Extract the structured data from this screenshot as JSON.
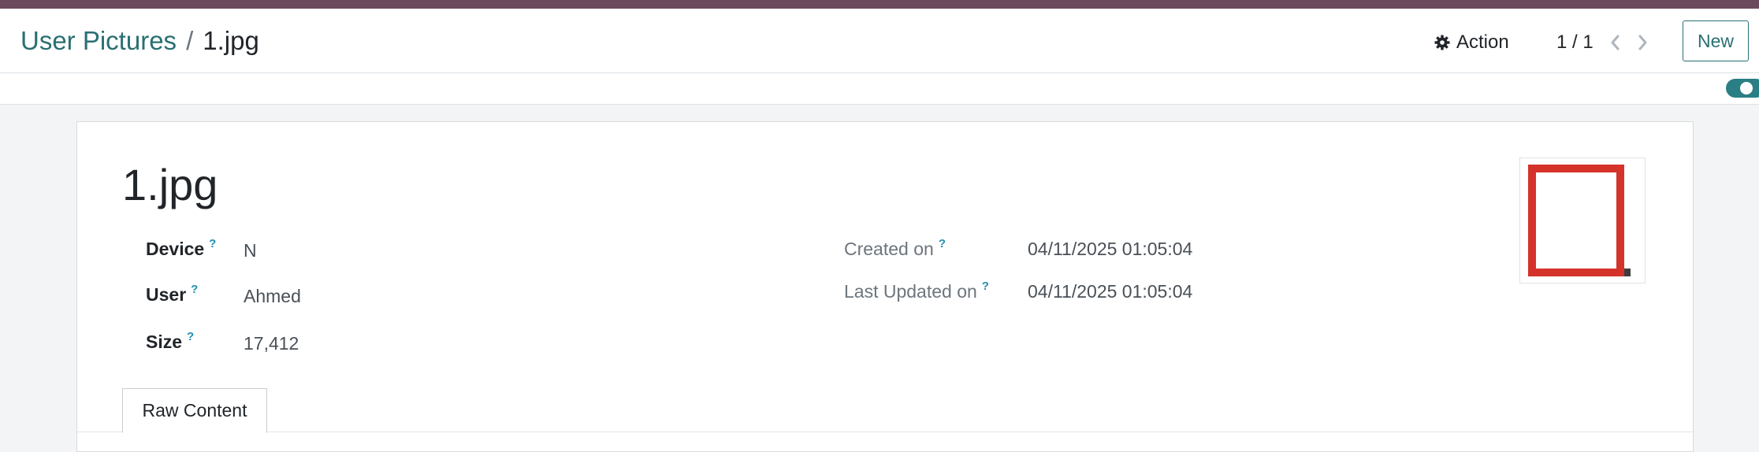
{
  "breadcrumb": {
    "parent": "User Pictures",
    "separator": "/",
    "current": "1.jpg"
  },
  "toolbar": {
    "action_label": "Action",
    "pager_value": "1 / 1",
    "new_label": "New"
  },
  "record": {
    "title": "1.jpg",
    "fields_left": [
      {
        "label": "Device",
        "help": "?",
        "value": "N"
      },
      {
        "label": "User",
        "help": "?",
        "value": "Ahmed"
      },
      {
        "label": "Size",
        "help": "?",
        "value": "17,412"
      }
    ],
    "fields_right": [
      {
        "label": "Created on",
        "help": "?",
        "value": "04/11/2025 01:05:04"
      },
      {
        "label": "Last Updated on",
        "help": "?",
        "value": "04/11/2025 01:05:04"
      }
    ]
  },
  "tabs": [
    {
      "label": "Raw Content",
      "active": true
    }
  ],
  "colors": {
    "brand_bar": "#6b4a5e",
    "accent": "#2a6f73",
    "help": "#1f8fb0",
    "image_frame": "#d4332b"
  },
  "icons": {
    "action": "gear-icon",
    "prev": "chevron-left-icon",
    "next": "chevron-right-icon"
  }
}
